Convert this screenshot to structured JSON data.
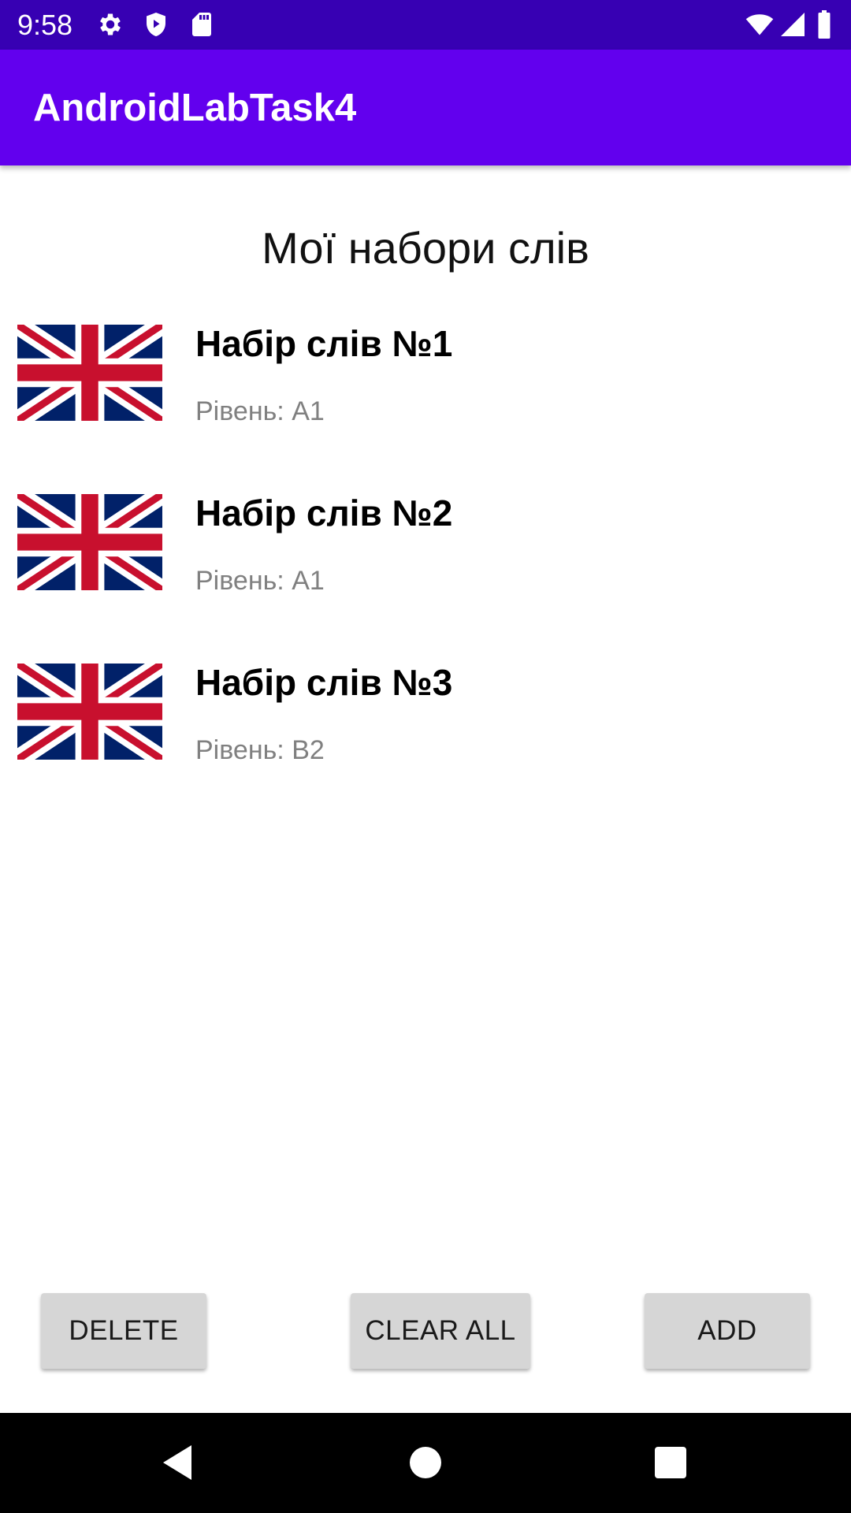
{
  "status_bar": {
    "time": "9:58",
    "left_icons": [
      "gear-icon",
      "shield-icon",
      "sd-card-icon"
    ],
    "right_icons": [
      "wifi-icon",
      "signal-icon",
      "battery-icon"
    ],
    "background": "#3700b3"
  },
  "app_bar": {
    "title": "AndroidLabTask4",
    "background": "#6200ee"
  },
  "main": {
    "title": "Мої набори слів",
    "word_sets": [
      {
        "title": "Набір слів №1",
        "level": "Рівень: A1",
        "icon": "uk-flag-icon"
      },
      {
        "title": "Набір слів №2",
        "level": "Рівень: A1",
        "icon": "uk-flag-icon"
      },
      {
        "title": "Набір слів №3",
        "level": "Рівень: B2",
        "icon": "uk-flag-icon"
      }
    ]
  },
  "actions": {
    "delete_label": "DELETE",
    "clear_all_label": "CLEAR ALL",
    "add_label": "ADD"
  },
  "nav_bar": {
    "icons": [
      "back-icon",
      "home-icon",
      "recents-icon"
    ]
  },
  "colors": {
    "flag_blue": "#012169",
    "flag_red": "#c8102e",
    "button_bg": "#d6d6d6",
    "secondary_text": "#808080"
  }
}
